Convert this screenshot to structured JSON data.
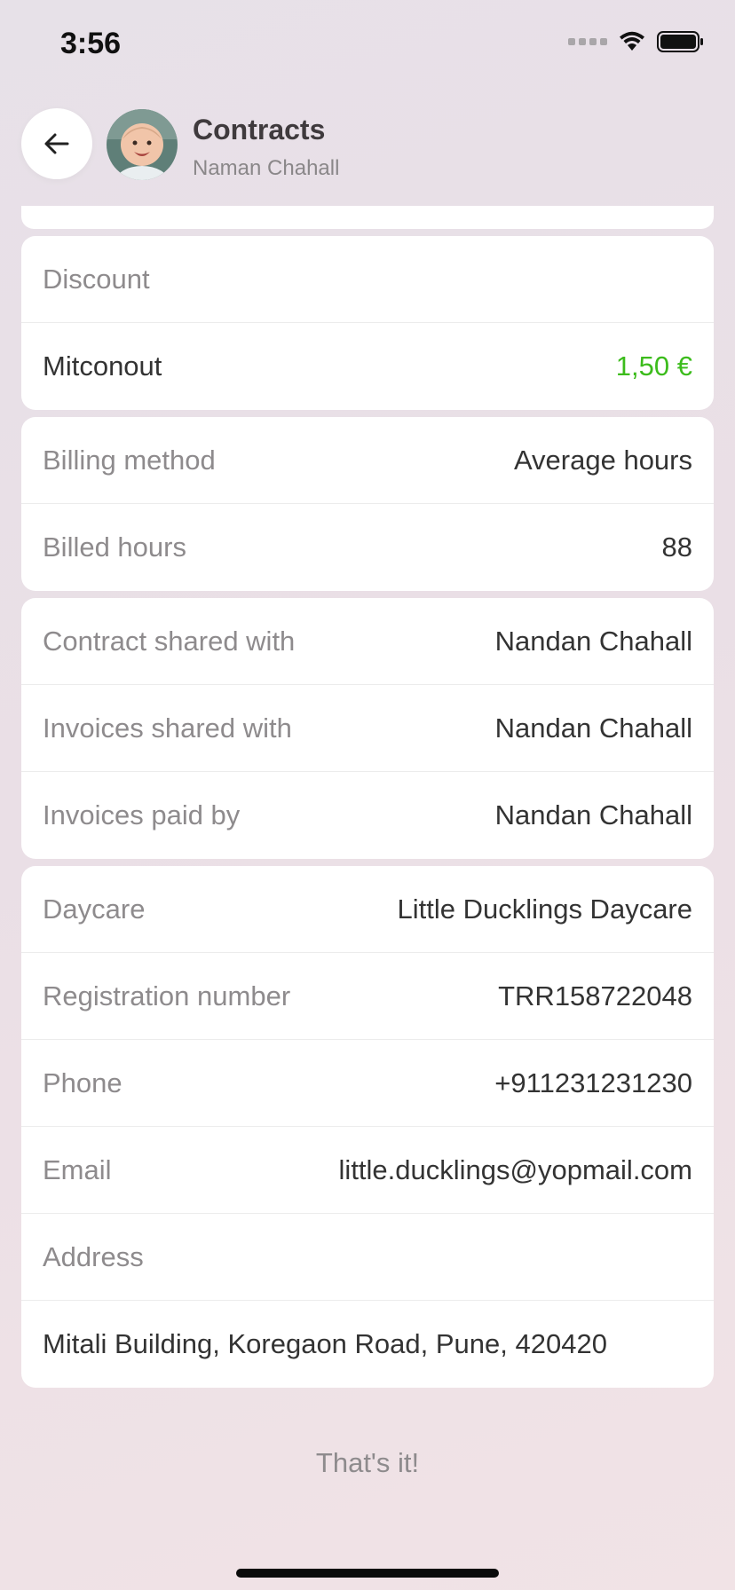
{
  "status_bar": {
    "time": "3:56"
  },
  "header": {
    "title": "Contracts",
    "subtitle": "Naman Chahall"
  },
  "discount_card": {
    "label": "Discount",
    "item_label": "Mitconout",
    "item_value": "1,50 €",
    "value_color": "#3cbc1c"
  },
  "billing_card": {
    "method_label": "Billing method",
    "method_value": "Average hours",
    "hours_label": "Billed hours",
    "hours_value": "88"
  },
  "sharing_card": {
    "contract_label": "Contract shared with",
    "contract_value": "Nandan Chahall",
    "invoices_label": "Invoices shared with",
    "invoices_value": "Nandan Chahall",
    "paid_label": "Invoices paid by",
    "paid_value": "Nandan Chahall"
  },
  "daycare_card": {
    "daycare_label": "Daycare",
    "daycare_value": "Little Ducklings Daycare",
    "reg_label": "Registration number",
    "reg_value": "TRR158722048",
    "phone_label": "Phone",
    "phone_value": "+911231231230",
    "email_label": "Email",
    "email_value": "little.ducklings@yopmail.com",
    "address_label": "Address",
    "address_value": "Mitali Building, Koregaon Road, Pune, 420420"
  },
  "footer": {
    "text": "That's it!"
  }
}
